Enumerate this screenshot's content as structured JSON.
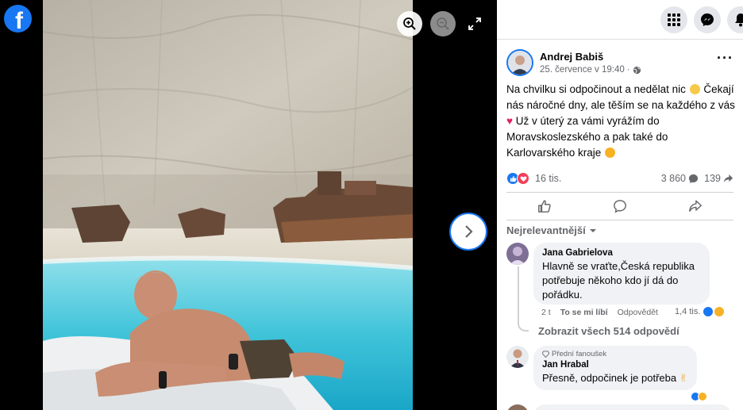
{
  "brand": {
    "logo_letter": "f",
    "color": "#1877f2"
  },
  "viewer": {
    "zoom_in_icon": "zoom-in-icon",
    "zoom_out_icon": "zoom-out-icon",
    "fullscreen_icon": "fullscreen-icon",
    "next_icon": "chevron-right-icon"
  },
  "topbar": {
    "icons": [
      "menu-grid-icon",
      "messenger-icon",
      "notifications-bell-icon"
    ]
  },
  "post": {
    "author": "Andrej Babiš",
    "date": "25. července v 19:40",
    "separator": "·",
    "audience_icon": "globe-icon",
    "more_icon": "more-options-icon",
    "text_parts": [
      "Na chvilku si odpočinout a nedělat nic",
      "Čekají nás náročné dny, ale těším se na každého z vás",
      "Už v úterý za vámi vyrážím do Moravskoslezského a pak také do Karlovarského kraje"
    ],
    "emojis": [
      "smiling-face-emoji",
      "red-heart-emoji",
      "grinning-face-emoji"
    ]
  },
  "reactions": {
    "count": "16 tis.",
    "comments": "3 860",
    "shares": "139",
    "types": [
      "like",
      "love"
    ]
  },
  "actions": {
    "like_icon": "thumbs-up-icon",
    "comment_icon": "comment-bubble-icon",
    "share_icon": "share-arrow-icon"
  },
  "comments": {
    "sort_label": "Nejrelevantnější",
    "items": [
      {
        "name": "Jana Gabrielova",
        "text": "Hlavně se vraťte,Česká republika potřebuje někoho kdo jí dá do pořádku.",
        "time": "2 t",
        "like_label": "To se mi líbí",
        "reply_label": "Odpovědět",
        "reactions": "1,4 tis."
      },
      {
        "badge": "Přední fanoušek",
        "name": "Jan Hrabal",
        "text": "Přesně, odpočinek je potřeba"
      }
    ],
    "show_replies": "Zobrazit všech 514 odpovědí"
  },
  "colors": {
    "accent": "#1877f2",
    "love": "#f33e58",
    "haha": "#f7b125",
    "secondary_text": "#65676b",
    "bubble": "#f0f2f5"
  }
}
